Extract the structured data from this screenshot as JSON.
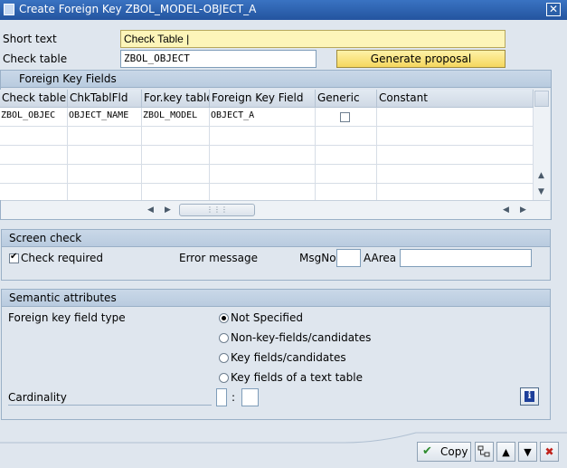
{
  "window": {
    "title": "Create Foreign Key ZBOL_MODEL-OBJECT_A",
    "close_glyph": "✕"
  },
  "form": {
    "short_text_label": "Short text",
    "short_text_value": "Check Table |",
    "check_table_label": "Check table",
    "check_table_value": "ZBOL_OBJECT",
    "generate_button": "Generate proposal"
  },
  "fk_fields": {
    "title": "Foreign Key Fields",
    "columns": [
      "Check table",
      "ChkTablFld",
      "For.key table",
      "Foreign Key Field",
      "Generic",
      "Constant"
    ],
    "rows": [
      {
        "check_table": "ZBOL_OBJEC",
        "chk_tab_fld": "OBJECT_NAME",
        "for_key_table": "ZBOL_MODEL",
        "foreign_key_field": "OBJECT_A",
        "generic": false,
        "constant": ""
      }
    ]
  },
  "screen_check": {
    "title": "Screen check",
    "check_required_label": "Check required",
    "check_required": true,
    "error_message_label": "Error message",
    "msgno_label": "MsgNo",
    "msgno_value": "",
    "aarea_label": "AArea",
    "aarea_value": ""
  },
  "semantic": {
    "title": "Semantic attributes",
    "fk_field_type_label": "Foreign key field type",
    "options": [
      "Not Specified",
      "Non-key-fields/candidates",
      "Key fields/candidates",
      "Key fields of a text table"
    ],
    "selected": "Not Specified",
    "cardinality_label": "Cardinality",
    "cardinality_left": "",
    "cardinality_sep": ":",
    "cardinality_right": "",
    "info_glyph": "i"
  },
  "toolbar": {
    "copy_label": "Copy",
    "check_glyph": "✔",
    "up_glyph": "▲",
    "down_glyph": "▼",
    "cancel_glyph": "✖"
  },
  "colors": {
    "title_bar": "#24549f",
    "accent_yellow": "#f5d75e",
    "panel_bg": "#dfe6ee",
    "copy_green": "#2e8b2e",
    "cancel_red": "#c0221b"
  }
}
